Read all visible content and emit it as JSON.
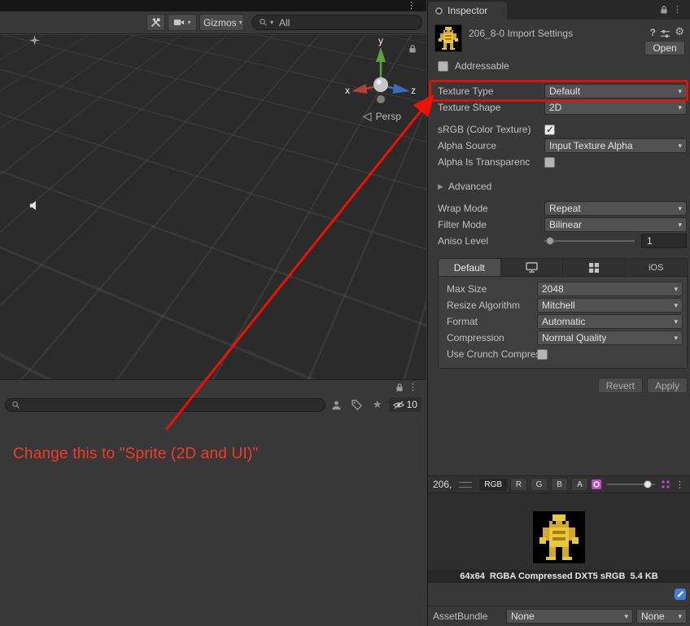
{
  "colors": {
    "annotation_red": "#f43b28",
    "highlight_red": "#ee1100",
    "sprite_yellow": "#e6c83c",
    "assetbundle_icon_blue": "#3f7fd6"
  },
  "scene": {
    "toolbar": {
      "gizmos": "Gizmos",
      "search_filter": "All"
    },
    "gizmo": {
      "x": "x",
      "y": "y",
      "z": "z",
      "persp": "Persp"
    }
  },
  "bottom_panel": {
    "hidden_count": "10"
  },
  "annotation": {
    "text": "Change this to \"Sprite (2D and UI)\""
  },
  "inspector": {
    "tab": "Inspector",
    "header": {
      "title": "206_8-0 Import Settings",
      "open": "Open"
    },
    "addressable": {
      "label": "Addressable",
      "checked": false
    },
    "settings": {
      "texture_type": {
        "label": "Texture Type",
        "value": "Default"
      },
      "texture_shape": {
        "label": "Texture Shape",
        "value": "2D"
      },
      "srgb": {
        "label": "sRGB (Color Texture)",
        "checked": true
      },
      "alpha_source": {
        "label": "Alpha Source",
        "value": "Input Texture Alpha"
      },
      "alpha_is_transparency": {
        "label": "Alpha Is Transparenc",
        "checked": false
      },
      "advanced": {
        "label": "Advanced"
      },
      "wrap_mode": {
        "label": "Wrap Mode",
        "value": "Repeat"
      },
      "filter_mode": {
        "label": "Filter Mode",
        "value": "Bilinear"
      },
      "aniso_level": {
        "label": "Aniso Level",
        "value": "1"
      }
    },
    "platform": {
      "tabs": {
        "default": "Default",
        "ios": "iOS"
      },
      "max_size": {
        "label": "Max Size",
        "value": "2048"
      },
      "resize_algorithm": {
        "label": "Resize Algorithm",
        "value": "Mitchell"
      },
      "format": {
        "label": "Format",
        "value": "Automatic"
      },
      "compression": {
        "label": "Compression",
        "value": "Normal Quality"
      },
      "crunch": {
        "label": "Use Crunch Compres",
        "checked": false
      }
    },
    "buttons": {
      "revert": "Revert",
      "apply": "Apply"
    },
    "preview": {
      "name": "206,",
      "channels": {
        "rgb": "RGB",
        "r": "R",
        "g": "G",
        "b": "B",
        "a": "A"
      },
      "info": "64x64  RGBA Compressed DXT5 sRGB  5.4 KB"
    },
    "assetbundle": {
      "label": "AssetBundle",
      "bundle": "None",
      "variant": "None"
    }
  }
}
